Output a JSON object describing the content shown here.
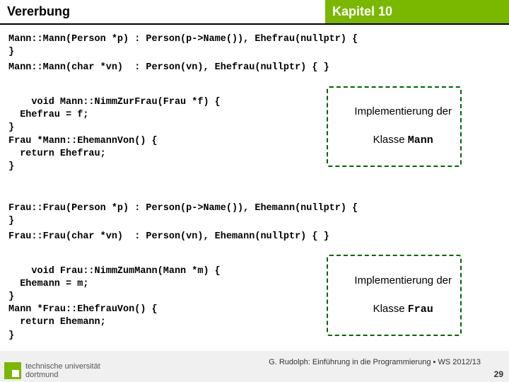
{
  "header": {
    "left": "Vererbung",
    "right": "Kapitel 10"
  },
  "code": {
    "mann_ctor1": "Mann::Mann(Person *p) : Person(p->Name()), Ehefrau(nullptr) {\n}",
    "mann_ctor2": "Mann::Mann(char *vn)  : Person(vn), Ehefrau(nullptr) { }",
    "mann_methods": "void Mann::NimmZurFrau(Frau *f) {\n  Ehefrau = f;\n}\nFrau *Mann::EhemannVon() {\n  return Ehefrau;\n}",
    "frau_ctor1": "Frau::Frau(Person *p) : Person(p->Name()), Ehemann(nullptr) {\n}",
    "frau_ctor2": "Frau::Frau(char *vn)  : Person(vn), Ehemann(nullptr) { }",
    "frau_methods": "void Frau::NimmZumMann(Mann *m) {\n  Ehemann = m;\n}\nMann *Frau::EhefrauVon() {\n  return Ehemann;\n}"
  },
  "callouts": {
    "mann_line1": "Implementierung der",
    "mann_line2a": "Klasse ",
    "mann_line2b": "Mann",
    "frau_line1": "Implementierung der",
    "frau_line2a": "Klasse ",
    "frau_line2b": "Frau"
  },
  "footer": {
    "uni1": "technische universität",
    "uni2": "dortmund",
    "credit": "G. Rudolph: Einführung in die Programmierung ▪ WS 2012/13",
    "page": "29"
  }
}
